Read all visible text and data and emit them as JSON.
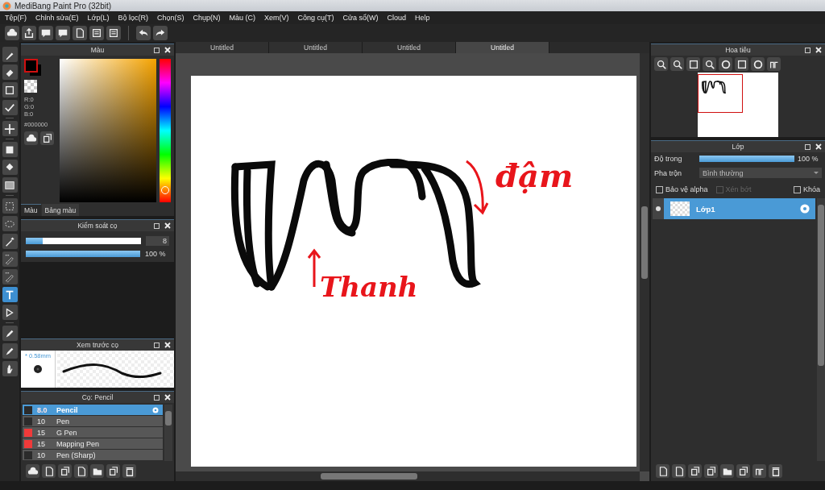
{
  "window": {
    "title": "MediBang Paint Pro (32bit)"
  },
  "menu": [
    "Tệp(F)",
    "Chỉnh sửa(E)",
    "Lớp(L)",
    "Bộ lọc(R)",
    "Chọn(S)",
    "Chụp(N)",
    "Màu (C)",
    "Xem(V)",
    "Công cụ(T)",
    "Cửa sổ(W)",
    "Cloud",
    "Help"
  ],
  "tools": [
    {
      "selected": false
    },
    {
      "selected": false
    },
    {
      "selected": false
    },
    {
      "selected": false
    },
    {
      "selected": false
    },
    {
      "selected": false
    },
    {
      "selected": false
    },
    {
      "selected": false
    },
    {
      "selected": false
    },
    {
      "selected": false
    },
    {
      "selected": false
    },
    {
      "selected": false
    },
    {
      "selected": false
    },
    {
      "selected": true
    },
    {
      "selected": false
    },
    {
      "selected": false
    },
    {
      "selected": false
    },
    {
      "selected": false
    }
  ],
  "color_panel": {
    "title": "Màu",
    "rgb": [
      "R:0",
      "G:0",
      "B:0"
    ],
    "hex": "#000000",
    "hue_slider": {
      "level": 0.08
    },
    "tabs": [
      {
        "label": "Màu",
        "selected": true
      },
      {
        "label": "Bảng màu",
        "selected": false
      }
    ]
  },
  "brush_control": {
    "title": "Kiểm soát cọ",
    "size": {
      "level": 0.15,
      "value": "8"
    },
    "opacity": {
      "level": 1,
      "value": "100 %"
    }
  },
  "brush_preview": {
    "title": "Xem trước cọ",
    "size": "* 0.58mm"
  },
  "brush_list": {
    "title": "Cọ: Pencil",
    "items": [
      {
        "color": "#2b2b2b",
        "size": "8.0",
        "name": "Pencil",
        "selected": true
      },
      {
        "color": "#2b2b2b",
        "size": "10",
        "name": "Pen",
        "selected": false
      },
      {
        "color": "#f03a3a",
        "size": "15",
        "name": "G Pen",
        "selected": false
      },
      {
        "color": "#f03a3a",
        "size": "15",
        "name": "Mapping Pen",
        "selected": false
      },
      {
        "color": "#2b2b2b",
        "size": "10",
        "name": "Pen (Sharp)",
        "selected": false
      }
    ]
  },
  "document_tabs": [
    {
      "label": "Untitled",
      "selected": false
    },
    {
      "label": "Untitled",
      "selected": false
    },
    {
      "label": "Untitled",
      "selected": false
    },
    {
      "label": "Untitled",
      "selected": true
    }
  ],
  "canvas": {
    "annotations": [
      "đậm",
      "Thanh"
    ]
  },
  "navigator": {
    "title": "Hoa tiêu"
  },
  "layers_panel": {
    "title": "Lớp",
    "opacity": {
      "label": "Độ trong",
      "level": 1,
      "value": "100 %"
    },
    "blend": {
      "label": "Pha trộn",
      "value": "Bình thường"
    },
    "options": [
      {
        "label": "Bảo vệ alpha",
        "checked": false,
        "disabled": false
      },
      {
        "label": "Xén bớt",
        "checked": false,
        "disabled": true
      },
      {
        "label": "Khóa",
        "checked": false,
        "disabled": false
      }
    ],
    "layers": [
      {
        "name": "Lớp1",
        "selected": true,
        "visible": true
      }
    ]
  }
}
